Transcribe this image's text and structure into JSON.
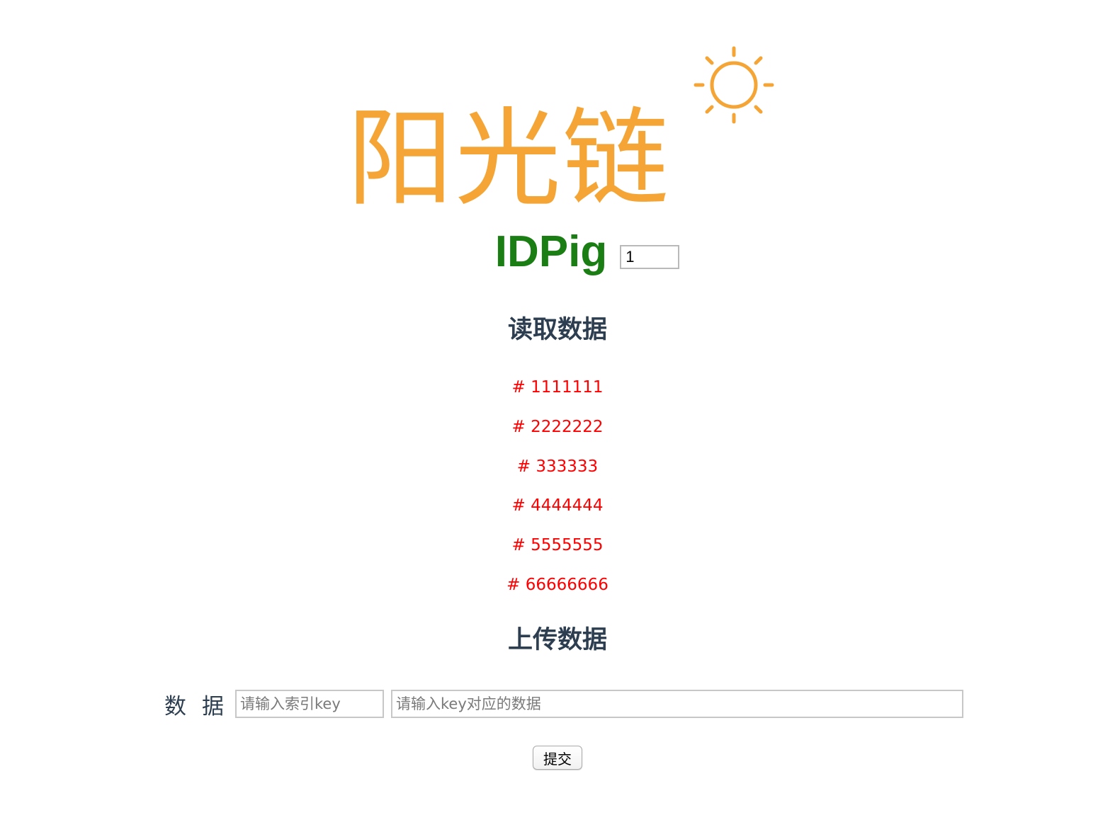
{
  "logo": {
    "text": "阳光链",
    "color": "#f4a535",
    "icon": "sun-icon"
  },
  "header": {
    "title": "IDPig",
    "title_color": "#1a7e14",
    "id_value": "1"
  },
  "read_section": {
    "title": "读取数据",
    "items": [
      "# 1111111",
      "# 2222222",
      "# 333333",
      "# 4444444",
      "# 5555555",
      "# 66666666"
    ],
    "item_color": "#ff0000"
  },
  "upload_section": {
    "title": "上传数据",
    "label": "数据",
    "key_placeholder": "请输入索引key",
    "value_placeholder": "请输入key对应的数据",
    "submit_label": "提交"
  }
}
